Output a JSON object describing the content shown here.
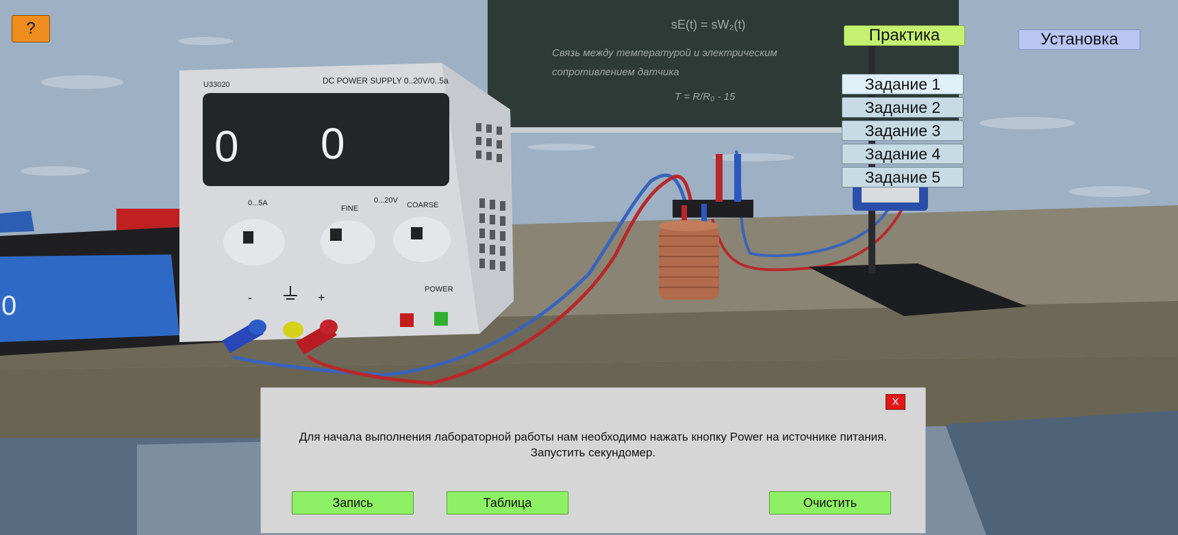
{
  "help_label": "?",
  "practice_label": "Практика",
  "setup_label": "Установка",
  "tasks": [
    "Задание 1",
    "Задание 2",
    "Задание 3",
    "Задание 4",
    "Задание 5"
  ],
  "psu": {
    "model": "U33020",
    "title": "DC POWER SUPPLY 0..20V/0..5a",
    "display_left": "0",
    "display_right": "0",
    "label_current": "0...5A",
    "label_fine": "FINE",
    "label_voltage": "0...20V",
    "label_coarse": "COARSE",
    "label_minus": "-",
    "label_plus": "+",
    "label_power": "POWER"
  },
  "left_display_digit": "0",
  "chalkboard": {
    "formula_top": "sE(t) = sW₂(t)",
    "line1": "Связь между температурой и электрическим",
    "line2": "сопротивлением датчика",
    "formula_bottom": "T = R/R₀ - 15"
  },
  "dialog": {
    "close_label": "X",
    "message": "Для начала выполнения лабораторной работы нам необходимо нажать кнопку Power на источнике питания. Запустить секундомер.",
    "record_label": "Запись",
    "table_label": "Таблица",
    "clear_label": "Очистить"
  },
  "colors": {
    "help": "#ef8d1e",
    "practice": "#c4f16f",
    "setup": "#b9c6f2",
    "task_active": "#dff0f6",
    "task": "#c7dbe4",
    "dialog_button": "#8ef064",
    "close": "#e01818"
  }
}
